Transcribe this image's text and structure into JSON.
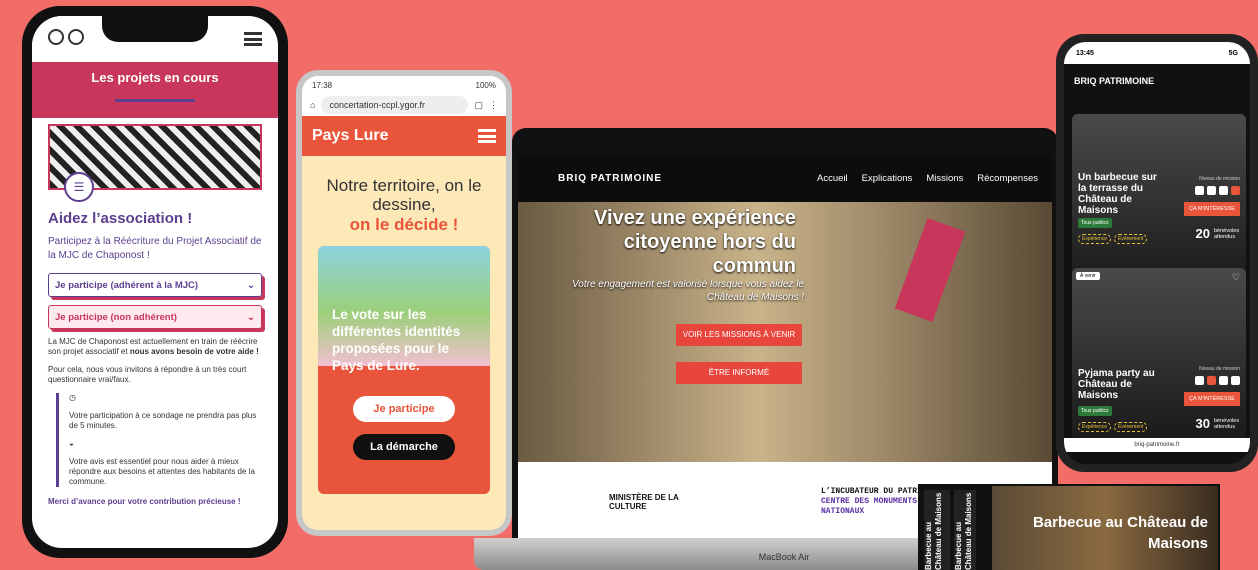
{
  "phone1": {
    "heading_band": "Les projets en cours",
    "title": "Aidez l’association !",
    "subtitle": "Participez à la Réécriture du Projet Associatif de la MJC de Chaponost !",
    "btn1": "Je participe (adhérent à la MJC)",
    "btn2": "Je participe (non adhérent)",
    "p1_a": "La MJC de Chaponost est actuellement en train de réécrire son projet associatif et ",
    "p1_b": "nous avons besoin de votre aide !",
    "p2": "Pour cela, nous vous invitons à répondre à un très court questionnaire vrai/faux.",
    "li1": "Votre participation à ce sondage ne prendra pas plus de 5 minutes.",
    "li2": "Votre avis est essentiel pour nous aider à mieux répondre aux besoins et attentes des habitants de la commune.",
    "merci": "Merci d’avance pour votre contribution précieuse !"
  },
  "phone2": {
    "time": "17:38",
    "battery": "100%",
    "url": "concertation-ccpl.ygor.fr",
    "brand": "Pays Lure",
    "h1": "Notre territoire, on le dessine,",
    "h1_em": "on le décide !",
    "card_text": "Le vote sur les différentes identités proposées pour le Pays de Lure.",
    "btn1": "Je participe",
    "btn2": "La démarche"
  },
  "laptop": {
    "logo": "BRIQ PATRIMOINE",
    "nav": [
      "Accueil",
      "Explications",
      "Missions",
      "Récompenses"
    ],
    "hero_title": "Vivez une expérience citoyenne hors du commun",
    "hero_sub": "Votre engagement est valorisé lorsque vous aidez le Château de Maisons !",
    "cta1": "VOIR LES MISSIONS À VENIR",
    "cta2": "ÊTRE INFORMÉ",
    "ministere": "MINISTÈRE DE LA CULTURE",
    "incubateur_1": "L’INCUBATEUR DU PATRIMOINE",
    "incubateur_2": "CENTRE DES MONUMENTS NATIONAUX",
    "model": "MacBook Air"
  },
  "phone3": {
    "time": "13:45",
    "signal": "5G",
    "logo": "BRIQ PATRIMOINE",
    "card1": {
      "title": "Un barbecue sur la terrasse du Château de Maisons",
      "tag": "Tous publics",
      "chips": [
        "Expérience",
        "Événement"
      ],
      "level": "Niveau de mission",
      "cta": "ÇA M’INTÉRESSE",
      "count": "20",
      "count_label": "bénévoles attendus"
    },
    "card2": {
      "badge": "À venir",
      "title": "Pyjama party au Château de Maisons",
      "tag": "Tous publics",
      "chips": [
        "Expérience",
        "Événement"
      ],
      "level": "Niveau de mission",
      "cta": "ÇA M’INTÉRESSE",
      "count": "30",
      "count_label": "bénévoles attendus"
    },
    "url": "briq-patrimoine.fr"
  },
  "flyer": {
    "side1": "Barbecue au Château de Maisons",
    "side2": "Barbecue au Château de Maisons",
    "title": "Barbecue au Château de Maisons"
  }
}
